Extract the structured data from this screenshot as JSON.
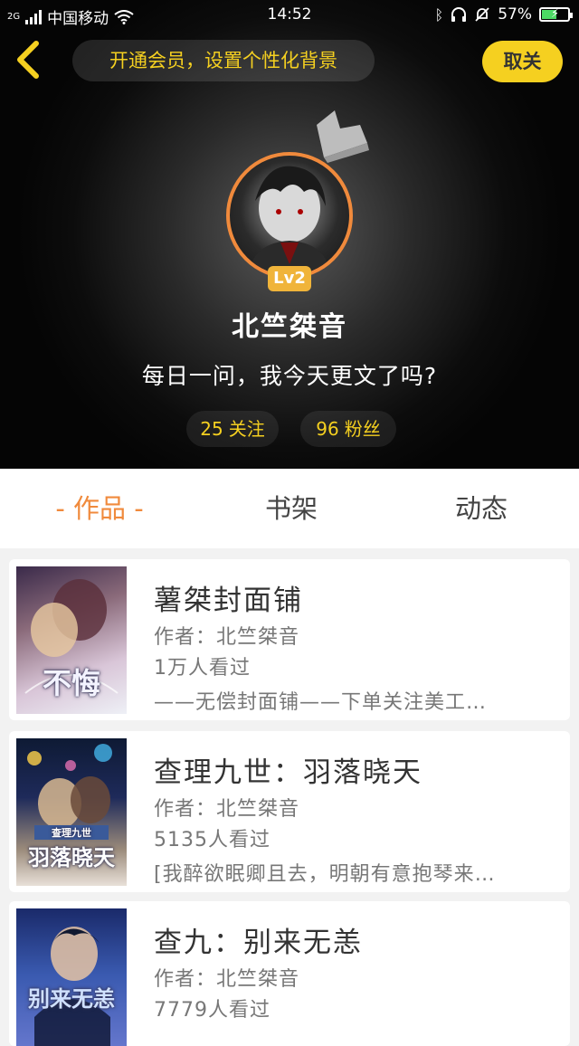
{
  "status_bar": {
    "network": "2G",
    "carrier": "中国移动",
    "time": "14:52",
    "battery": "57%",
    "battery_level": 0.57
  },
  "header": {
    "vip_banner": "开通会员，设置个性化背景",
    "unfollow_label": "取关"
  },
  "profile": {
    "level": "Lv2",
    "username": "北竺桀音",
    "signature": "每日一问，我今天更文了吗?",
    "following_count": "25",
    "following_label": "关注",
    "followers_count": "96",
    "followers_label": "粉丝"
  },
  "tabs": [
    {
      "label": "- 作品 -",
      "active": true
    },
    {
      "label": "书架",
      "active": false
    },
    {
      "label": "动态",
      "active": false
    }
  ],
  "works": [
    {
      "cover_text": "不悔",
      "title": "薯桀封面铺",
      "author": "作者：北竺桀音",
      "views": "1万人看过",
      "desc": "——无偿封面铺——下单关注美工…"
    },
    {
      "cover_text": "羽落晓天",
      "cover_subtitle": "查理九世",
      "title": "查理九世：羽落晓天",
      "author": "作者：北竺桀音",
      "views": "5135人看过",
      "desc": "[我醉欲眠卿且去，明朝有意抱琴来…"
    },
    {
      "cover_text": "别来无恙",
      "title": "查九：别来无恙",
      "author": "作者：北竺桀音",
      "views": "7779人看过",
      "desc": ""
    }
  ],
  "colors": {
    "accent_yellow": "#f5d020",
    "accent_orange": "#f08a3c"
  }
}
